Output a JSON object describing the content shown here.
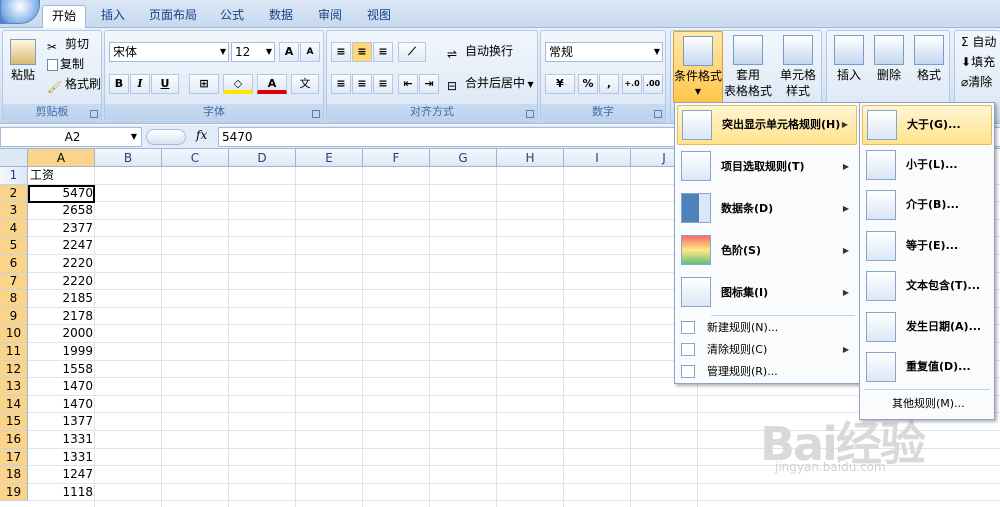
{
  "tabs": [
    "开始",
    "插入",
    "页面布局",
    "公式",
    "数据",
    "审阅",
    "视图"
  ],
  "ribbon": {
    "clipboard": {
      "label": "剪贴板",
      "paste": "粘贴",
      "cut": "剪切",
      "copy": "复制",
      "format_painter": "格式刷"
    },
    "font": {
      "label": "字体",
      "font_name": "宋体",
      "font_size": "12",
      "bold": "B",
      "italic": "I",
      "underline": "U",
      "grow": "A",
      "shrink": "A",
      "color_glyph": "A",
      "phonetic": "文"
    },
    "alignment": {
      "label": "对齐方式",
      "wrap_text": "自动换行",
      "merge_center": "合并后居中"
    },
    "number": {
      "label": "数字",
      "format": "常规",
      "percent": "%",
      "comma": ","
    },
    "styles": {
      "conditional_format": "条件格式",
      "table_format_1": "套用",
      "table_format_2": "表格格式",
      "cell_styles_1": "单元格",
      "cell_styles_2": "样式"
    },
    "cells": {
      "insert": "插入",
      "delete": "删除",
      "format": "格式"
    },
    "editing": {
      "autosum": "自动",
      "fill": "填充",
      "clear": "清除"
    }
  },
  "formula_bar": {
    "name_box": "A2",
    "fx": "fx",
    "content": "5470"
  },
  "columns": [
    "A",
    "B",
    "C",
    "D",
    "E",
    "F",
    "G",
    "H",
    "I",
    "J"
  ],
  "rows": [
    {
      "num": "1",
      "value": "工资"
    },
    {
      "num": "2",
      "value": "5470"
    },
    {
      "num": "3",
      "value": "2658"
    },
    {
      "num": "4",
      "value": "2377"
    },
    {
      "num": "5",
      "value": "2247"
    },
    {
      "num": "6",
      "value": "2220"
    },
    {
      "num": "7",
      "value": "2220"
    },
    {
      "num": "8",
      "value": "2185"
    },
    {
      "num": "9",
      "value": "2178"
    },
    {
      "num": "10",
      "value": "2000"
    },
    {
      "num": "11",
      "value": "1999"
    },
    {
      "num": "12",
      "value": "1558"
    },
    {
      "num": "13",
      "value": "1470"
    },
    {
      "num": "14",
      "value": "1470"
    },
    {
      "num": "15",
      "value": "1377"
    },
    {
      "num": "16",
      "value": "1331"
    },
    {
      "num": "17",
      "value": "1331"
    },
    {
      "num": "18",
      "value": "1247"
    },
    {
      "num": "19",
      "value": "1118"
    }
  ],
  "cf_menu": {
    "items": [
      "突出显示单元格规则(H)",
      "项目选取规则(T)",
      "数据条(D)",
      "色阶(S)",
      "图标集(I)"
    ],
    "small_items": [
      "新建规则(N)...",
      "清除规则(C)",
      "管理规则(R)..."
    ]
  },
  "sub_menu": {
    "items": [
      "大于(G)...",
      "小于(L)...",
      "介于(B)...",
      "等于(E)...",
      "文本包含(T)...",
      "发生日期(A)...",
      "重复值(D)..."
    ],
    "other": "其他规则(M)..."
  },
  "watermark": {
    "text": "Bai经验",
    "url": "jingyan.baidu.com"
  },
  "colors": {
    "accent": "#15428b",
    "highlight": "#ffe28b",
    "selected_header": "#f9d48a"
  }
}
